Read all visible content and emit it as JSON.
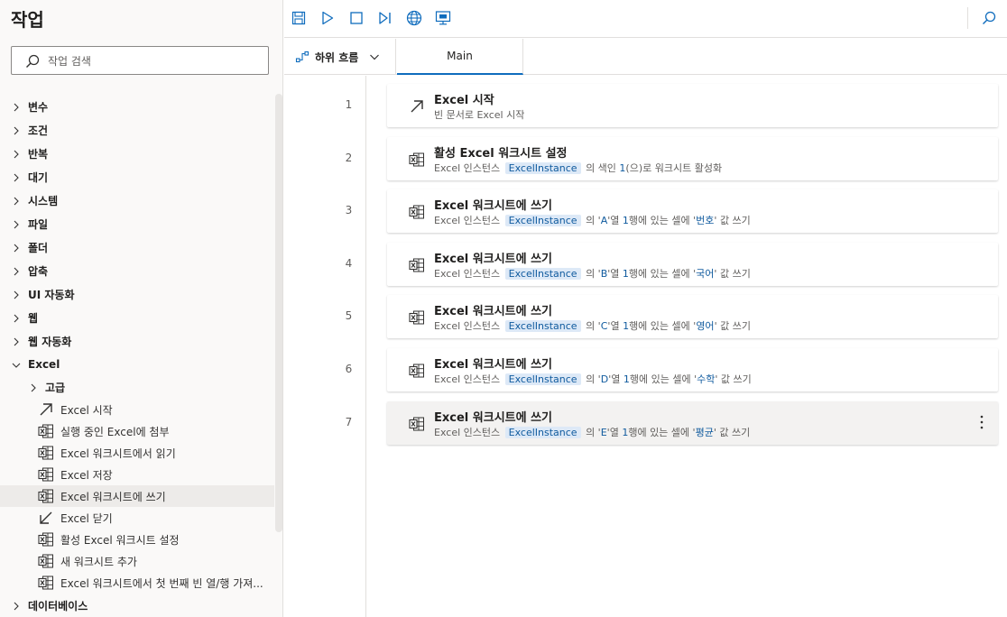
{
  "left": {
    "title": "작업",
    "search_placeholder": "작업 검색",
    "categories": [
      {
        "label": "변수"
      },
      {
        "label": "조건"
      },
      {
        "label": "반복"
      },
      {
        "label": "대기"
      },
      {
        "label": "시스템"
      },
      {
        "label": "파일"
      },
      {
        "label": "폴더"
      },
      {
        "label": "압축"
      },
      {
        "label": "UI 자동화"
      },
      {
        "label": "웹"
      },
      {
        "label": "웹 자동화"
      }
    ],
    "excel": {
      "label": "Excel",
      "advanced_label": "고급",
      "actions": [
        {
          "label": "Excel 시작",
          "icon": "arrow-up-right-icon"
        },
        {
          "label": "실행 중인 Excel에 첨부",
          "icon": "excel-icon"
        },
        {
          "label": "Excel 워크시트에서 읽기",
          "icon": "excel-icon"
        },
        {
          "label": "Excel 저장",
          "icon": "excel-icon"
        },
        {
          "label": "Excel 워크시트에 쓰기",
          "icon": "excel-icon"
        },
        {
          "label": "Excel 닫기",
          "icon": "arrow-down-left-icon"
        },
        {
          "label": "활성 Excel 워크시트 설정",
          "icon": "excel-icon"
        },
        {
          "label": "새 워크시트 추가",
          "icon": "excel-icon"
        },
        {
          "label": "Excel 워크시트에서 첫 번째 빈 열/행 가져...",
          "icon": "excel-icon"
        }
      ]
    },
    "last_category": "데이터베이스"
  },
  "toolbar": {
    "icons": [
      "save-icon",
      "run-icon",
      "stop-icon",
      "step-icon",
      "web-recorder-icon",
      "desktop-recorder-icon",
      "search-icon"
    ]
  },
  "tabs": {
    "subflow_label": "하위 흐름",
    "main_label": "Main"
  },
  "steps": [
    {
      "num": "1",
      "title": "Excel 시작",
      "desc_parts": {
        "a": "빈 문서로 Excel 시작"
      }
    },
    {
      "num": "2",
      "title": "활성 Excel 워크시트 설정",
      "pre": "Excel 인스턴스",
      "token": "ExcelInstance",
      "mid": "의 색인",
      "index": "1",
      "post": "(으)로 워크시트 활성화"
    },
    {
      "num": "3",
      "title": "Excel 워크시트에 쓰기",
      "pre": "Excel 인스턴스",
      "token": "ExcelInstance",
      "col": "A",
      "row": "1",
      "value": "번호"
    },
    {
      "num": "4",
      "title": "Excel 워크시트에 쓰기",
      "pre": "Excel 인스턴스",
      "token": "ExcelInstance",
      "col": "B",
      "row": "1",
      "value": "국어"
    },
    {
      "num": "5",
      "title": "Excel 워크시트에 쓰기",
      "pre": "Excel 인스턴스",
      "token": "ExcelInstance",
      "col": "C",
      "row": "1",
      "value": "영어"
    },
    {
      "num": "6",
      "title": "Excel 워크시트에 쓰기",
      "pre": "Excel 인스턴스",
      "token": "ExcelInstance",
      "col": "D",
      "row": "1",
      "value": "수학"
    },
    {
      "num": "7",
      "title": "Excel 워크시트에 쓰기",
      "pre": "Excel 인스턴스",
      "token": "ExcelInstance",
      "col": "E",
      "row": "1",
      "value": "평균"
    }
  ],
  "write_text": {
    "of": "의",
    "col_suffix": "열",
    "row_suffix": "행에 있는 셀에",
    "tail": "값 쓰기"
  },
  "colors": {
    "accent": "#0f6cbd",
    "token_bg": "#dde9f7",
    "excel_green": "#323130"
  }
}
